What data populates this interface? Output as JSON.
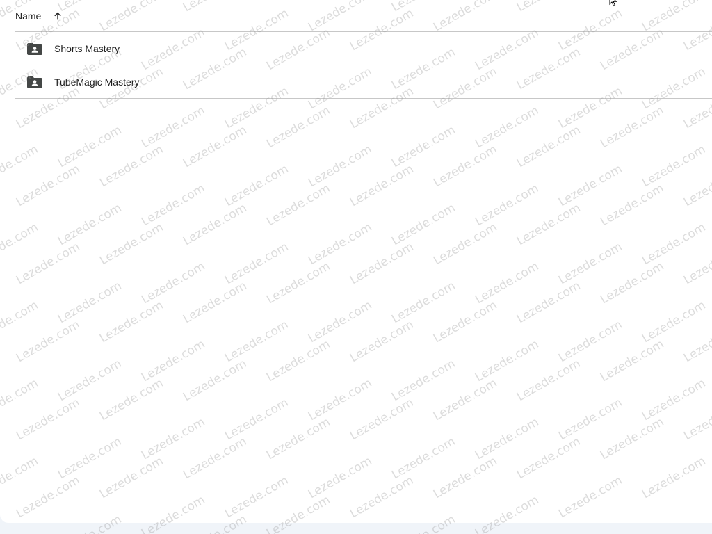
{
  "header": {
    "name_label": "Name",
    "sort_icon": "arrow-upward-icon"
  },
  "rows": [
    {
      "label": "Shorts Mastery",
      "icon": "shared-folder-icon"
    },
    {
      "label": "TubeMagic Mastery",
      "icon": "shared-folder-icon"
    }
  ],
  "watermark": {
    "text": "Lezede.com"
  },
  "colors": {
    "text": "#1f1f1f",
    "icon": "#444746",
    "divider": "#c7c7c7",
    "background": "#f0f4f9"
  }
}
